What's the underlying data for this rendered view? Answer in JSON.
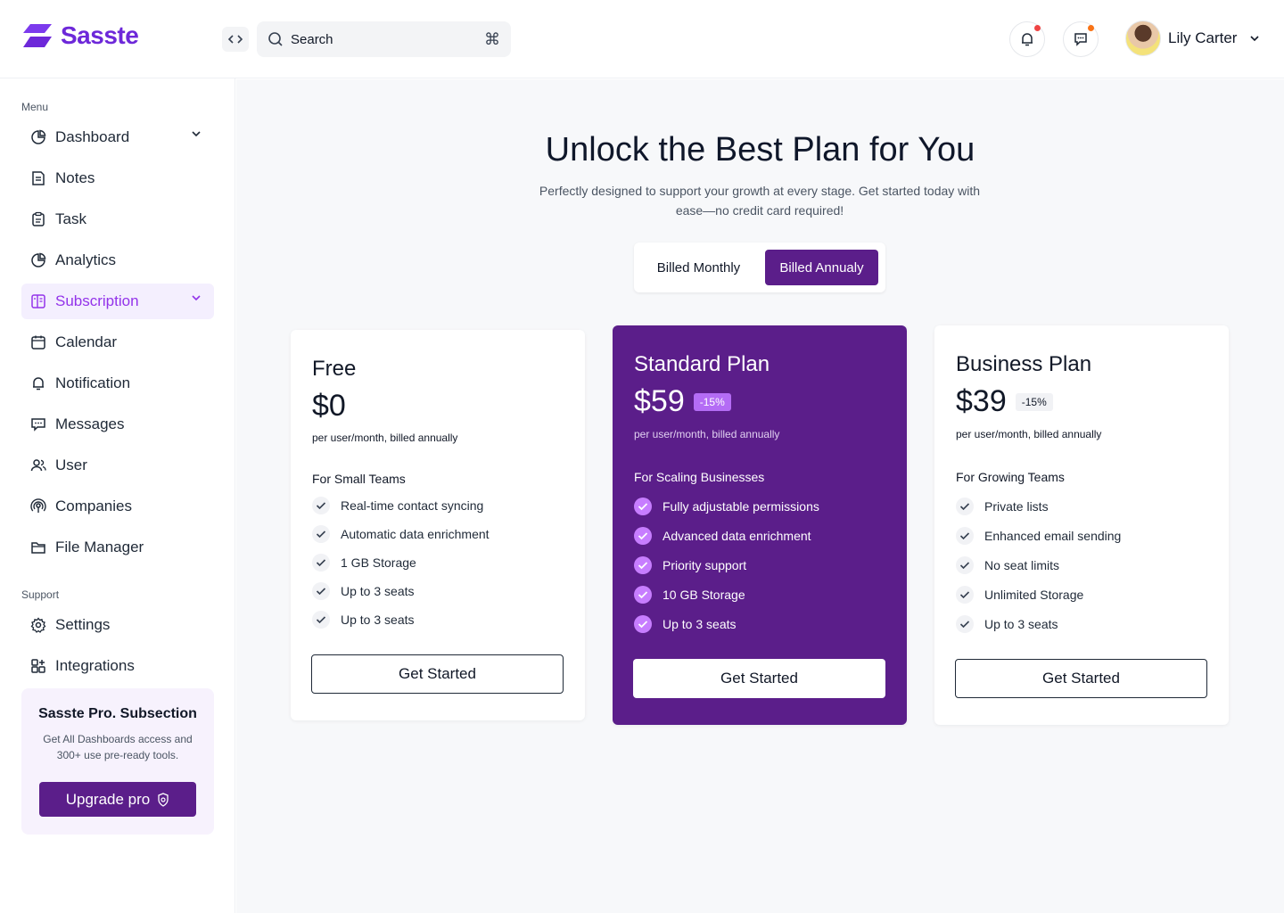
{
  "app": {
    "logo_text": "Sasste",
    "brand_color": "#7c3aed",
    "accent_color": "#5b1e8a"
  },
  "header": {
    "collapse_icon": "code-brackets-icon",
    "search": {
      "placeholder": "Search",
      "shortcut_glyph": "⌘"
    },
    "notifications_icon": "bell-icon",
    "messages_icon": "chat-icon",
    "user": {
      "name": "Lily Carter"
    }
  },
  "sidebar": {
    "menu_label": "Menu",
    "items": [
      {
        "label": "Dashboard",
        "icon": "pie-chart-icon",
        "has_caret": true,
        "active": false
      },
      {
        "label": "Notes",
        "icon": "note-icon"
      },
      {
        "label": "Task",
        "icon": "clipboard-icon"
      },
      {
        "label": "Analytics",
        "icon": "pie-chart-icon"
      },
      {
        "label": "Subscription",
        "icon": "layout-icon",
        "has_caret": true,
        "active": true
      },
      {
        "label": "Calendar",
        "icon": "calendar-icon"
      },
      {
        "label": "Notification",
        "icon": "bell-icon"
      },
      {
        "label": "Messages",
        "icon": "chat-icon"
      },
      {
        "label": "User",
        "icon": "users-icon"
      },
      {
        "label": "Companies",
        "icon": "broadcast-icon"
      },
      {
        "label": "File Manager",
        "icon": "folder-icon"
      }
    ],
    "support_label": "Support",
    "support_items": [
      {
        "label": "Settings",
        "icon": "gear-icon"
      },
      {
        "label": "Integrations",
        "icon": "apps-icon"
      }
    ],
    "promo": {
      "title": "Sasste Pro. Subsection",
      "description": "Get All Dashboards access and 300+ use pre-ready tools.",
      "button_label": "Upgrade pro"
    }
  },
  "main": {
    "title": "Unlock the Best Plan for You",
    "subtitle": "Perfectly designed to support your growth at every stage. Get started today with ease—no credit card required!",
    "billing_toggle": {
      "monthly_label": "Billed Monthly",
      "annual_label": "Billed Annualy",
      "selected": "annual"
    },
    "plans": [
      {
        "name": "Free",
        "price": "$0",
        "discount": "",
        "billing_note": "per user/month, billed annually",
        "audience": "For Small Teams",
        "features": [
          "Real-time contact syncing",
          "Automatic data enrichment",
          "1 GB Storage",
          "Up to 3 seats",
          "Up to 3 seats"
        ],
        "cta": "Get Started"
      },
      {
        "name": "Standard Plan",
        "price": "$59",
        "discount": "-15%",
        "billing_note": "per user/month, billed annually",
        "audience": "For Scaling Businesses",
        "features": [
          "Fully adjustable permissions",
          "Advanced data enrichment",
          "Priority support",
          "10 GB Storage",
          "Up to 3 seats"
        ],
        "cta": "Get Started",
        "highlighted": true
      },
      {
        "name": "Business Plan",
        "price": "$39",
        "discount": "-15%",
        "billing_note": "per user/month, billed annually",
        "audience": "For Growing Teams",
        "features": [
          "Private lists",
          "Enhanced email sending",
          "No seat limits",
          "Unlimited Storage",
          "Up to 3 seats"
        ],
        "cta": "Get Started"
      }
    ]
  }
}
